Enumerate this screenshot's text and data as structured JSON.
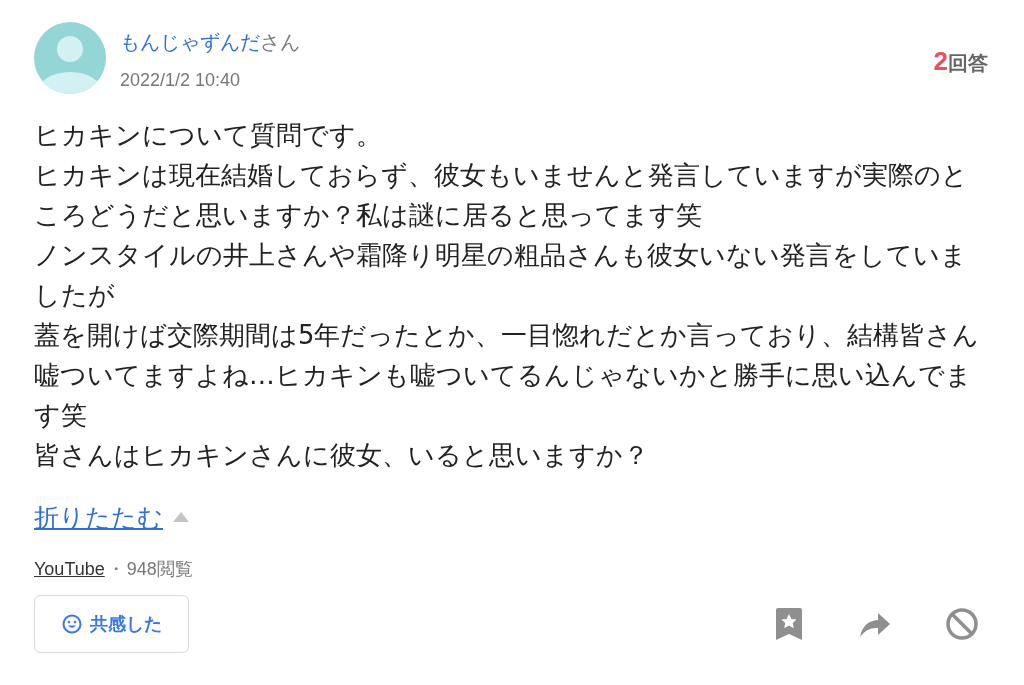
{
  "question": {
    "author": {
      "name": "もんじゃずんだ",
      "suffix": "さん"
    },
    "date": "2022/1/2 10:40",
    "answers": {
      "count": "2",
      "label": "回答"
    },
    "body": [
      "ヒカキンについて質問です。",
      "ヒカキンは現在結婚しておらず、彼女もいませんと発言していますが実際のところどうだと思いますか？私は謎に居ると思ってます笑",
      "ノンスタイルの井上さんや霜降り明星の粗品さんも彼女いない発言をしていましたが",
      "蓋を開けば交際期間は5年だったとか、一目惚れだとか言っており、結構皆さん嘘ついてますよね…ヒカキンも嘘ついてるんじゃないかと勝手に思い込んでます笑",
      "皆さんはヒカキンさんに彼女、いると思いますか？"
    ],
    "collapse_link": "折りたたむ",
    "category": "YouTube",
    "separator": "・",
    "views": "948閲覧",
    "empathy_button": "共感した"
  }
}
